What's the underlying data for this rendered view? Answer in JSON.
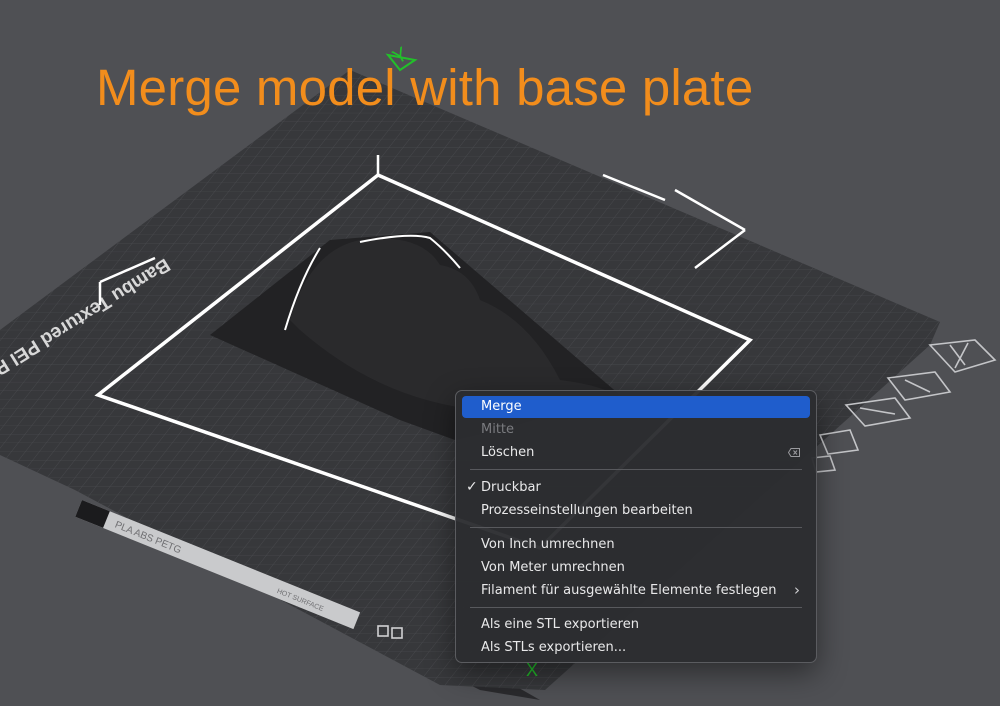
{
  "caption": "Merge model with base plate",
  "plate": {
    "name": "Bambu Textured PEI Plate",
    "label_strip": "PLA ABS PETG",
    "tag": "HOT SURFACE",
    "axis_y_label": "Y",
    "axis_x_label": "X"
  },
  "menu": {
    "items": {
      "merge": "Merge",
      "center": "Mitte",
      "delete": "Löschen",
      "printable": "Druckbar",
      "printable_checkmark": "✓",
      "process_settings": "Prozesseinstellungen bearbeiten",
      "convert_inch": "Von Inch umrechnen",
      "convert_meter": "Von Meter umrechnen",
      "set_filament": "Filament für ausgewählte Elemente festlegen",
      "submenu_arrow": "›",
      "export_one_stl": "Als eine STL exportieren",
      "export_stls": "Als STLs exportieren..."
    },
    "highlighted": "merge",
    "disabled": [
      "center"
    ],
    "delete_shortcut_icon": "delete-backward-icon"
  },
  "plate_toolbar_icons": [
    "close-icon",
    "auto-orient-icon",
    "arrange-icon",
    "lock-icon",
    "settings-icon"
  ],
  "colors": {
    "caption": "#f28d1c",
    "menu_highlight": "#1f5dcc",
    "axis_y": "#22c02a",
    "axis_x": "#22c02a",
    "background": "#4f5054"
  }
}
